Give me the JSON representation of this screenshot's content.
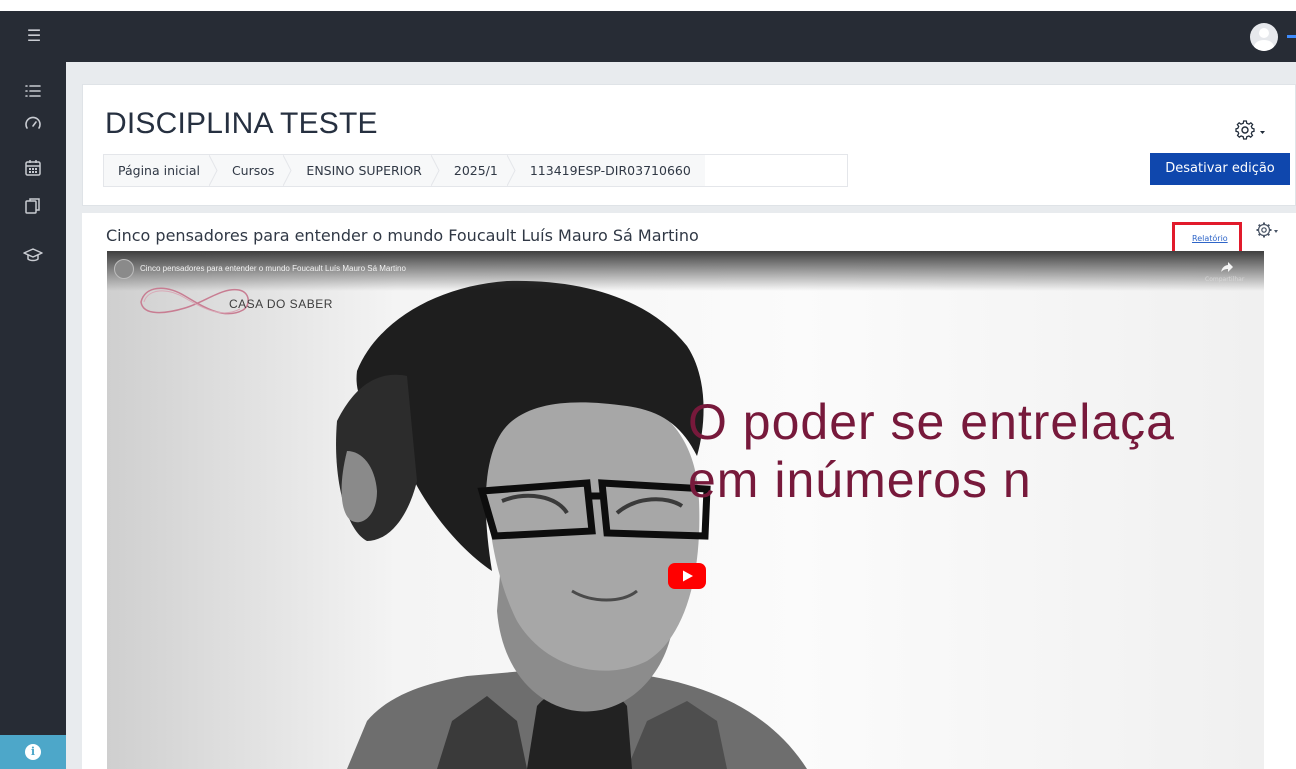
{
  "topbar": {
    "menu_icon": "hamburger-menu-icon",
    "avatar_icon": "user-avatar-icon"
  },
  "sidebar": {
    "items": [
      {
        "icon": "list-icon",
        "label": ""
      },
      {
        "icon": "dashboard-gauge-icon",
        "label": ""
      },
      {
        "icon": "calendar-icon",
        "label": ""
      },
      {
        "icon": "files-icon",
        "label": ""
      },
      {
        "icon": "graduation-cap-icon",
        "label": ""
      }
    ],
    "info_icon": "info-icon"
  },
  "header": {
    "title": "DISCIPLINA TESTE",
    "breadcrumb": [
      "Página inicial",
      "Cursos",
      "ENSINO SUPERIOR",
      "2025/1",
      "113419ESP-DIR03710660"
    ],
    "edit_button_label": "Desativar edição",
    "gear_icon": "settings-gear-icon"
  },
  "activity": {
    "title": "Cinco pensadores para entender o mundo Foucault Luís Mauro Sá Martino",
    "report_link_label": "Relatório",
    "gear_icon": "settings-gear-icon"
  },
  "video": {
    "overlay_title": "Cinco pensadores para entender o mundo Foucault Luís Mauro Sá Martino",
    "share_label": "Compartilhar",
    "logo_text": "CASA DO SABER",
    "quote_line1": "O poder se entrelaça",
    "quote_line2": "em inúmeros n",
    "play_icon": "youtube-play-icon"
  },
  "colors": {
    "topbar": "#272c35",
    "content_bg": "#e8ebee",
    "primary_button": "#0f47ad",
    "highlight_box": "#e11a2b",
    "quote_text": "#77193b",
    "youtube_red": "#ff0000"
  }
}
